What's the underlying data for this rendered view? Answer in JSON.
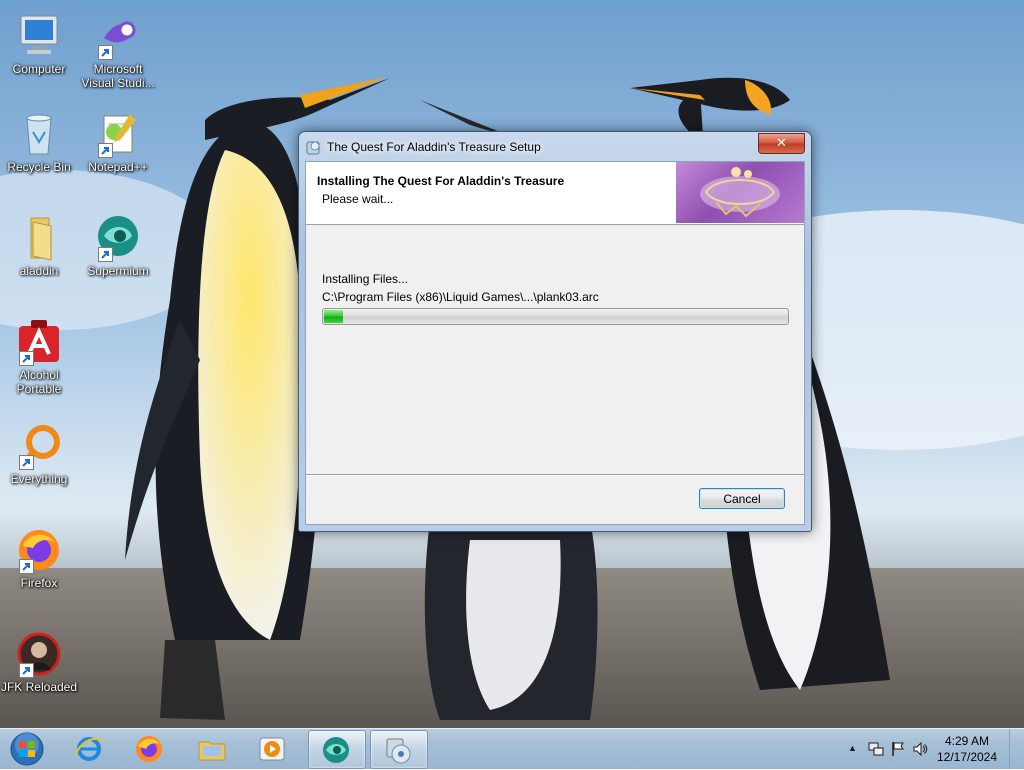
{
  "desktop": {
    "icons": [
      {
        "label": "Computer",
        "shortcut": false,
        "icon": "computer-icon"
      },
      {
        "label": "Microsoft Visual Studi...",
        "shortcut": true,
        "icon": "visual-studio-icon"
      },
      {
        "label": "Recycle Bin",
        "shortcut": false,
        "icon": "recycle-bin-icon"
      },
      {
        "label": "Notepad++",
        "shortcut": true,
        "icon": "notepadpp-icon"
      },
      {
        "label": "aladdin",
        "shortcut": false,
        "icon": "folder-icon"
      },
      {
        "label": "Supermium",
        "shortcut": true,
        "icon": "supermium-icon"
      },
      {
        "label": "Alcohol Portable",
        "shortcut": true,
        "icon": "alcohol-icon"
      },
      {
        "label": "Everything",
        "shortcut": true,
        "icon": "everything-icon"
      },
      {
        "label": "Firefox",
        "shortcut": true,
        "icon": "firefox-icon"
      },
      {
        "label": "JFK Reloaded",
        "shortcut": true,
        "icon": "jfk-reloaded-icon"
      }
    ]
  },
  "installer": {
    "window_title": "The Quest For Aladdin's Treasure Setup",
    "close_label": "✕",
    "header_title": "Installing The Quest For Aladdin's Treasure",
    "header_subtitle": "Please wait...",
    "status_text": "Installing Files...",
    "current_file": "C:\\Program Files (x86)\\Liquid Games\\...\\plank03.arc",
    "progress_fraction": 0.04,
    "cancel_label": "Cancel",
    "logo_icon": "aladdin-logo"
  },
  "taskbar": {
    "start_icon": "windows-start-orb",
    "buttons": [
      {
        "name": "internet-explorer",
        "icon": "internet-explorer-icon",
        "active": false
      },
      {
        "name": "firefox",
        "icon": "firefox-icon",
        "active": false
      },
      {
        "name": "file-explorer",
        "icon": "folder-icon",
        "active": false
      },
      {
        "name": "media-player",
        "icon": "media-player-icon",
        "active": false
      },
      {
        "name": "supermium",
        "icon": "supermium-icon",
        "active": true
      },
      {
        "name": "installer",
        "icon": "setup-disc-icon",
        "active": true
      }
    ],
    "tray": {
      "chevron": "▲",
      "time": "4:29 AM",
      "date": "12/17/2024"
    }
  },
  "colors": {
    "accent_blue": "#3c7fb1",
    "close_red": "#c13a23",
    "progress_green": "#2fc42f",
    "logo_purple": "#8e4fb0"
  }
}
